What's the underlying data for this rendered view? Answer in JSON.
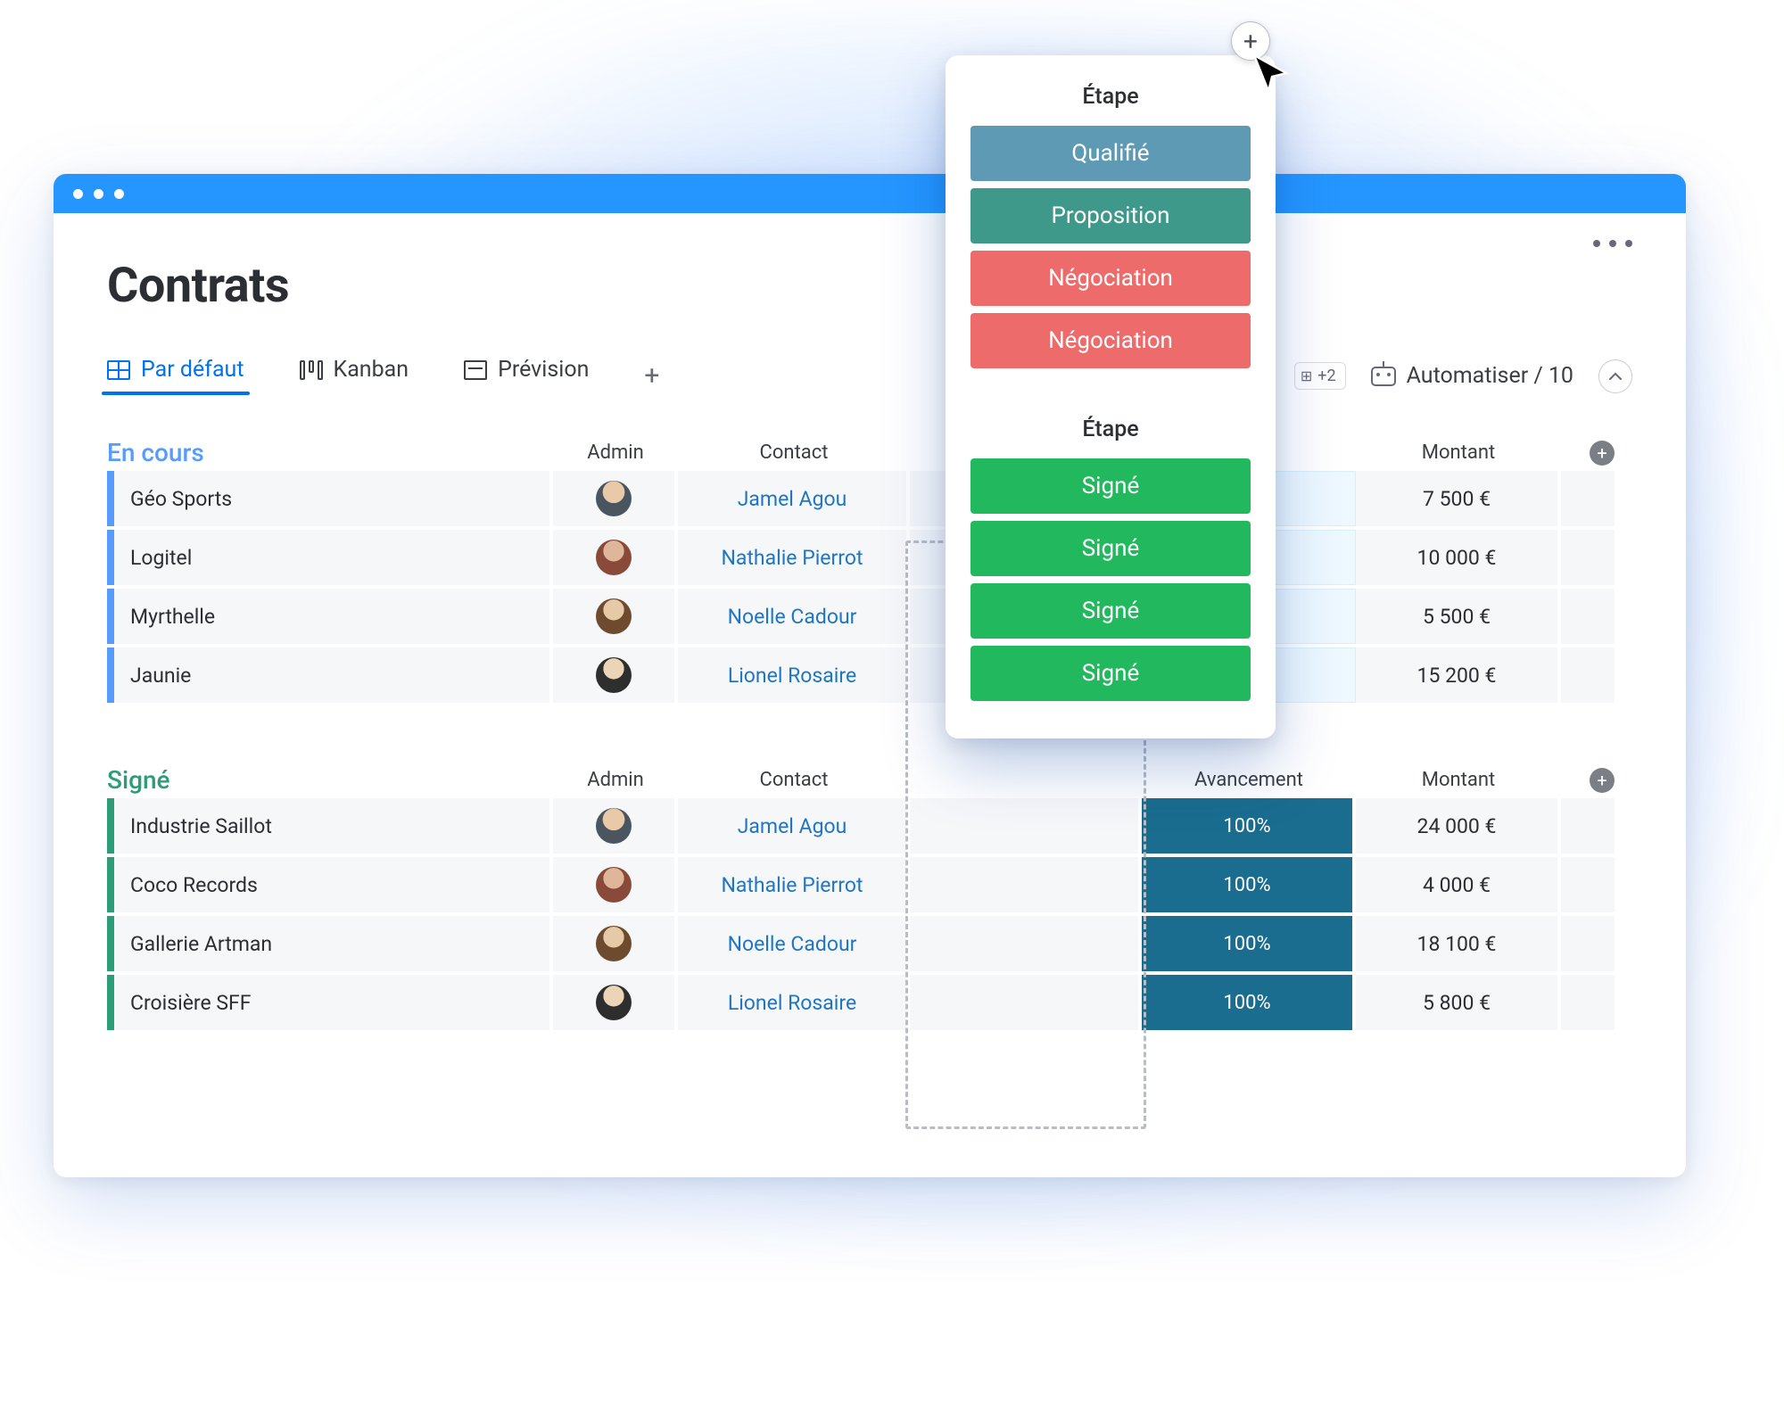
{
  "page_title": "Contrats",
  "tabs": {
    "default": "Par défaut",
    "kanban": "Kanban",
    "forecast": "Prévision"
  },
  "toolbar": {
    "more_count": "+2",
    "automate": "Automatiser / 10"
  },
  "columns": {
    "admin": "Admin",
    "contact": "Contact",
    "progress": "Avancement",
    "amount": "Montant"
  },
  "groups": [
    {
      "id": "in_progress",
      "title": "En cours",
      "color": "blue",
      "rows": [
        {
          "name": "Géo Sports",
          "avatar": "av1",
          "contact": "Jamel Agou",
          "amount": "7 500 €"
        },
        {
          "name": "Logitel",
          "avatar": "av2",
          "contact": "Nathalie Pierrot",
          "amount": "10 000 €"
        },
        {
          "name": "Myrthelle",
          "avatar": "av3",
          "contact": "Noelle Cadour",
          "amount": "5 500 €"
        },
        {
          "name": "Jaunie",
          "avatar": "av4",
          "contact": "Lionel Rosaire",
          "amount": "15 200 €"
        }
      ]
    },
    {
      "id": "signed",
      "title": "Signé",
      "color": "green",
      "rows": [
        {
          "name": "Industrie Saillot",
          "avatar": "av1",
          "contact": "Jamel Agou",
          "progress": "100%",
          "amount": "24 000 €"
        },
        {
          "name": "Coco Records",
          "avatar": "av2",
          "contact": "Nathalie Pierrot",
          "progress": "100%",
          "amount": "4 000 €"
        },
        {
          "name": "Gallerie Artman",
          "avatar": "av3",
          "contact": "Noelle Cadour",
          "progress": "100%",
          "amount": "18 100 €"
        },
        {
          "name": "Croisière SFF",
          "avatar": "av4",
          "contact": "Lionel Rosaire",
          "progress": "100%",
          "amount": "5 800 €"
        }
      ]
    }
  ],
  "popover": {
    "heading": "Étape",
    "section1": [
      "Qualifié",
      "Proposition",
      "Négociation",
      "Négociation"
    ],
    "section2": [
      "Signé",
      "Signé",
      "Signé",
      "Signé"
    ]
  }
}
